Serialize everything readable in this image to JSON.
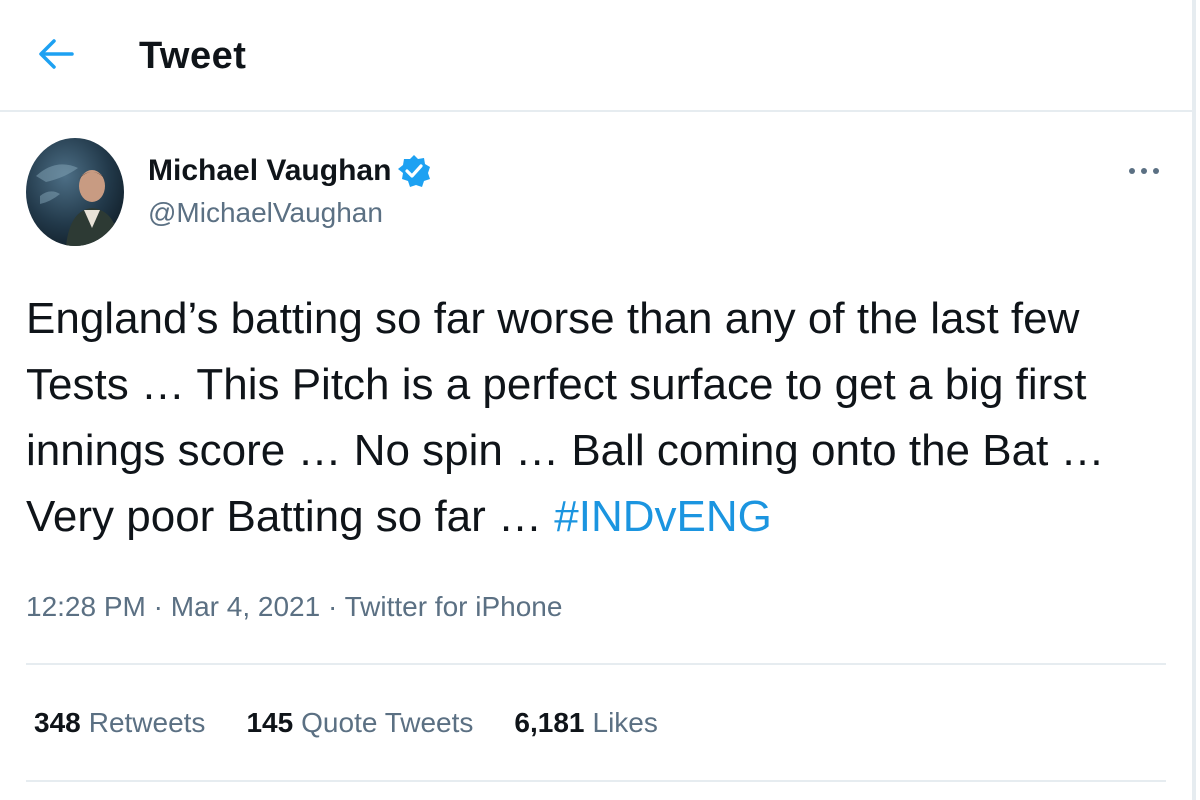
{
  "header": {
    "title": "Tweet",
    "back_icon": "arrow-left-icon",
    "accent": "#1da1f2"
  },
  "tweet": {
    "author_name": "Michael Vaughan",
    "author_handle": "@MichaelVaughan",
    "verified": true,
    "text_lines": [
      "England’s batting so far worse than any of the last few",
      "Tests … This Pitch is a perfect surface to get a big first",
      "innings score … No spin … Ball coming onto the Bat …",
      "Very poor Batting so far … "
    ],
    "hashtag": "#INDvENG",
    "time": "12:28 PM",
    "date": "Mar 4, 2021",
    "source": "Twitter for iPhone",
    "separator": " · "
  },
  "stats": {
    "retweets": {
      "count": "348",
      "label": "Retweets"
    },
    "quote_tweets": {
      "count": "145",
      "label": "Quote Tweets"
    },
    "likes": {
      "count": "6,181",
      "label": "Likes"
    }
  },
  "colors": {
    "text": "#0f1419",
    "secondary": "#5b7083",
    "link": "#1b95e0",
    "border": "#e6ecf0"
  }
}
